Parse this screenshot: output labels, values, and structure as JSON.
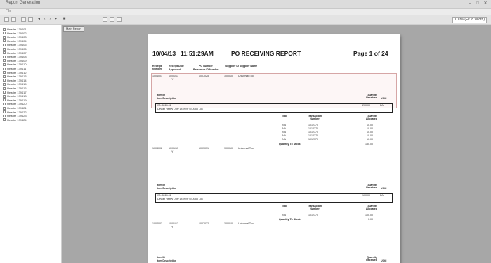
{
  "window": {
    "title": "Report Generation",
    "menu": "File"
  },
  "toolbar": {
    "zoom": "100% (Fit to Width)"
  },
  "sidebar": {
    "items": [
      "Header 139401",
      "Header 139402",
      "Header 139403",
      "Header 139404",
      "Header 139405",
      "Header 139406",
      "Header 139407",
      "Header 139408",
      "Header 139409",
      "Header 139410",
      "Header 139411",
      "Header 139412",
      "Header 139413",
      "Header 139414",
      "Header 139415",
      "Header 139416",
      "Header 139417",
      "Header 139418",
      "Header 139419",
      "Header 139420",
      "Header 139421",
      "Header 139422",
      "Header 139423",
      "Header 139424"
    ]
  },
  "viewer": {
    "tab_label": "Main Report"
  },
  "report": {
    "date": "10/04/13",
    "time": "11:51:29AM",
    "title": "PO RECEIVING REPORT",
    "page": "Page 1 of 24",
    "col_receipt_number": "Receipt Number",
    "col_receipt_date": "Receipt Date",
    "col_receipt_date2": "Approved",
    "col_po_number": "PO Number",
    "col_po_number2": "Reference ID Number",
    "col_supplier_id": "Supplier ID",
    "col_supplier_name": "Supplier Name",
    "row1": {
      "receipt": "1004001",
      "date": "10/01/13",
      "flag": "Y",
      "po": "1007025",
      "supplier_id": "100010",
      "supplier_name": "Universal Tool"
    },
    "item_id_label": "Item ID",
    "item_desc_label": "Item Description",
    "qty_received_label": "Quantity Received",
    "uom_label": "UOM",
    "item1": {
      "id": "WL-8014-02",
      "desc": "Dewalt Heavy Duty 18 dWP w/Quick Lok",
      "qty": "200.00",
      "uom": "EA"
    },
    "type_label": "Type",
    "trans_label": "Transaction Number",
    "qty_alloc_label": "Quantity Allocated",
    "alloc_rows": [
      {
        "type": "INA",
        "trans": "1012370",
        "qty": "10.00"
      },
      {
        "type": "INA",
        "trans": "1012370",
        "qty": "10.00"
      },
      {
        "type": "INA",
        "trans": "1012370",
        "qty": "10.00"
      },
      {
        "type": "INA",
        "trans": "1012370",
        "qty": "10.00"
      },
      {
        "type": "INA",
        "trans": "1012370",
        "qty": "10.00"
      }
    ],
    "qty_to_stock_label": "Quantity To Stock:",
    "qty_to_stock_1": "150.00",
    "row2": {
      "receipt": "1004002",
      "date": "10/01/13",
      "flag": "Y",
      "po": "1007031",
      "supplier_id": "100010",
      "supplier_name": "Universal Tool"
    },
    "item2": {
      "id": "WL-8014-02",
      "desc": "Dewalt Heavy Duty 18 dWP w/Quick Lok",
      "qty": "100.00",
      "uom": "EA"
    },
    "alloc2": {
      "type": "INA",
      "trans": "1012370",
      "qty": "100.00"
    },
    "qty_to_stock_2": "0.00",
    "row3": {
      "receipt": "1004003",
      "date": "10/01/13",
      "flag": "Y",
      "po": "1007032",
      "supplier_id": "100010",
      "supplier_name": "Universal Tool"
    }
  }
}
